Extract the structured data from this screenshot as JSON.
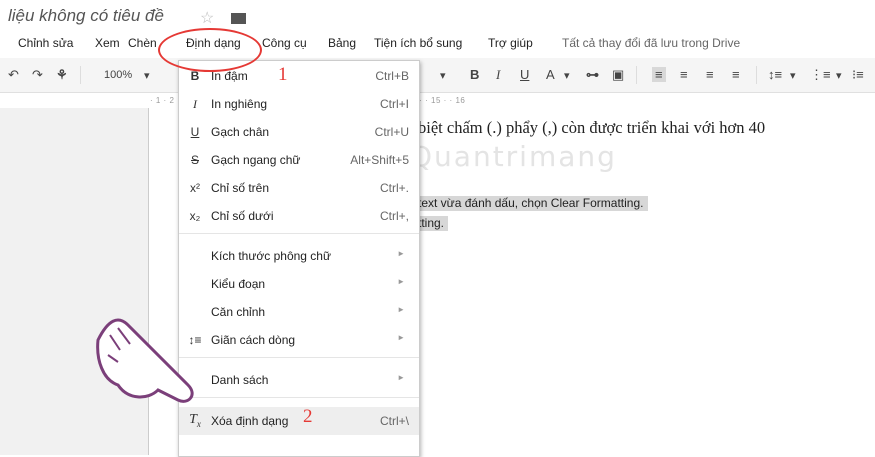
{
  "doc": {
    "title": "liệu không có tiêu đề",
    "star_icon": "star-icon",
    "folder_icon": "folder-icon"
  },
  "menubar": {
    "items": [
      "Chỉnh sửa",
      "Xem",
      "Chèn",
      "Định dạng",
      "Công cụ",
      "Bảng",
      "Tiện ích bổ sung",
      "Trợ giúp"
    ],
    "saved_status": "Tất cả thay đổi đã lưu trong Drive"
  },
  "toolbar": {
    "zoom": "100%"
  },
  "ruler": {
    "ticks": "· 1 · 2 ·  ·  ·  ·  ·  · 5 · · 6 · · 7 · · 8 · · 9 · · 10 · · 11 · · 12 · · 13 · · 14 · · 15 · · 16"
  },
  "format_menu": {
    "bold": {
      "label": "In đậm",
      "shortcut": "Ctrl+B",
      "icon": "B"
    },
    "italic": {
      "label": "In nghiêng",
      "shortcut": "Ctrl+I",
      "icon": "I"
    },
    "underline": {
      "label": "Gạch chân",
      "shortcut": "Ctrl+U",
      "icon": "U"
    },
    "strike": {
      "label": "Gạch ngang chữ",
      "shortcut": "Alt+Shift+5",
      "icon": "S"
    },
    "superscript": {
      "label": "Chỉ số trên",
      "shortcut": "Ctrl+.",
      "icon": "x²"
    },
    "subscript": {
      "label": "Chỉ số dưới",
      "shortcut": "Ctrl+,",
      "icon": "x₂"
    },
    "font_size": {
      "label": "Kích thước phông chữ"
    },
    "para_style": {
      "label": "Kiểu đoạn"
    },
    "align": {
      "label": "Căn chỉnh"
    },
    "line_spacing": {
      "label": "Giãn cách dòng"
    },
    "lists": {
      "label": "Danh sách"
    },
    "clear_format": {
      "label": "Xóa định dạng",
      "shortcut": "Ctrl+\\"
    }
  },
  "document_body": {
    "line1": "biệt chấm (.) phẩy (,) còn được triển khai với hơn 40",
    "line2": "text vừa đánh dấu, chọn Clear Formatting.",
    "line3": "tting."
  },
  "annotations": {
    "num1": "1",
    "num2": "2",
    "watermark": "Quantrimang",
    "accent": "#e53935"
  }
}
